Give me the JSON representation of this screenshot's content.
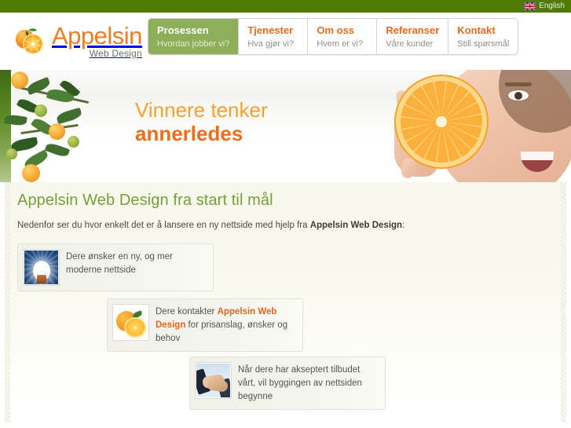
{
  "topbar": {
    "language_label": "English",
    "flag_icon": "uk-flag-icon",
    "bar_color": "#4e7a00"
  },
  "logo": {
    "title": "Appelsin",
    "subtitle": "Web Design",
    "icon": "orange-fruit-icon",
    "title_color": "#f47c20"
  },
  "nav": {
    "items": [
      {
        "title": "Prosessen",
        "sub": "Hvordan jobber vi?",
        "active": true
      },
      {
        "title": "Tjenester",
        "sub": "Hva gjør vi?",
        "active": false
      },
      {
        "title": "Om oss",
        "sub": "Hvem er vi?",
        "active": false
      },
      {
        "title": "Referanser",
        "sub": "Våre kunder",
        "active": false
      },
      {
        "title": "Kontakt",
        "sub": "Still spørsmål",
        "active": false
      }
    ],
    "active_color": "#8fae5a",
    "link_color": "#ea6a1e"
  },
  "hero": {
    "line1": "Vinnere tenker",
    "line2": "annerledes",
    "line1_color": "#f9a02c",
    "line2_color": "#ef6c1a",
    "left_image": "orange-tree-branch-image",
    "right_image": "woman-holding-orange-slice-image"
  },
  "main": {
    "title": "Appelsin Web Design fra start til mål",
    "title_color": "#76a03c",
    "intro_before": "Nedenfor ser du hvor enkelt det er å lansere en ny nettside med hjelp fra ",
    "intro_brand": "Appelsin Web Design",
    "intro_after": ":",
    "steps": [
      {
        "icon": "lightbulb-idea-icon",
        "text": "Dere ønsker en ny, og mer moderne nettside"
      },
      {
        "icon": "orange-fruit-icon",
        "text_before": "Dere kontakter ",
        "brand": "Appelsin Web Design",
        "text_after": " for prisanslag, ønsker og behov"
      },
      {
        "icon": "handshake-icon",
        "text": "Når dere har akseptert tilbudet vårt, vil byggingen av nettsiden begynne"
      }
    ],
    "brand_color": "#e8651b"
  }
}
